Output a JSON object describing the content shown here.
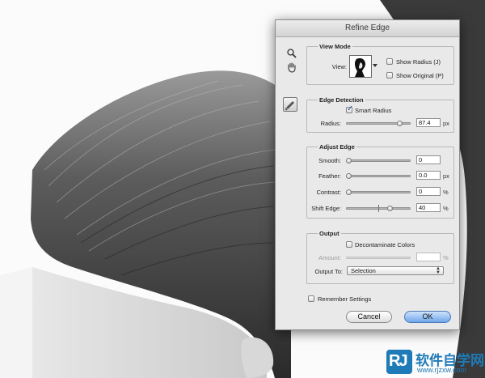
{
  "dialog": {
    "title": "Refine Edge",
    "tools": {
      "zoom": "magnifier-icon",
      "hand": "hand-icon",
      "brush": "refine-radius-brush-icon"
    }
  },
  "view_mode": {
    "title": "View Mode",
    "view_label": "View:",
    "show_radius": {
      "label": "Show Radius (J)",
      "checked": false
    },
    "show_original": {
      "label": "Show Original (P)",
      "checked": false
    }
  },
  "edge_detection": {
    "title": "Edge Detection",
    "smart_radius": {
      "label": "Smart Radius",
      "checked": true
    },
    "radius": {
      "label": "Radius:",
      "value": "87.4",
      "unit": "px",
      "fraction": 0.86
    }
  },
  "adjust_edge": {
    "title": "Adjust Edge",
    "smooth": {
      "label": "Smooth:",
      "value": "0",
      "unit": "",
      "fraction": 0.0
    },
    "feather": {
      "label": "Feather:",
      "value": "0.0",
      "unit": "px",
      "fraction": 0.0
    },
    "contrast": {
      "label": "Contrast:",
      "value": "0",
      "unit": "%",
      "fraction": 0.0
    },
    "shift_edge": {
      "label": "Shift Edge:",
      "value": "40",
      "unit": "%",
      "fraction": 0.7
    }
  },
  "output": {
    "title": "Output",
    "decontaminate": {
      "label": "Decontaminate Colors",
      "checked": false
    },
    "amount": {
      "label": "Amount:",
      "value": "",
      "unit": "%",
      "disabled": true
    },
    "output_to": {
      "label": "Output To:",
      "selected": "Selection"
    }
  },
  "remember": {
    "label": "Remember Settings",
    "checked": false
  },
  "buttons": {
    "cancel": "Cancel",
    "ok": "OK"
  },
  "watermark": {
    "logo": "RJ",
    "text_cn": "软件自学网",
    "url": "www.rjzxw.com"
  }
}
